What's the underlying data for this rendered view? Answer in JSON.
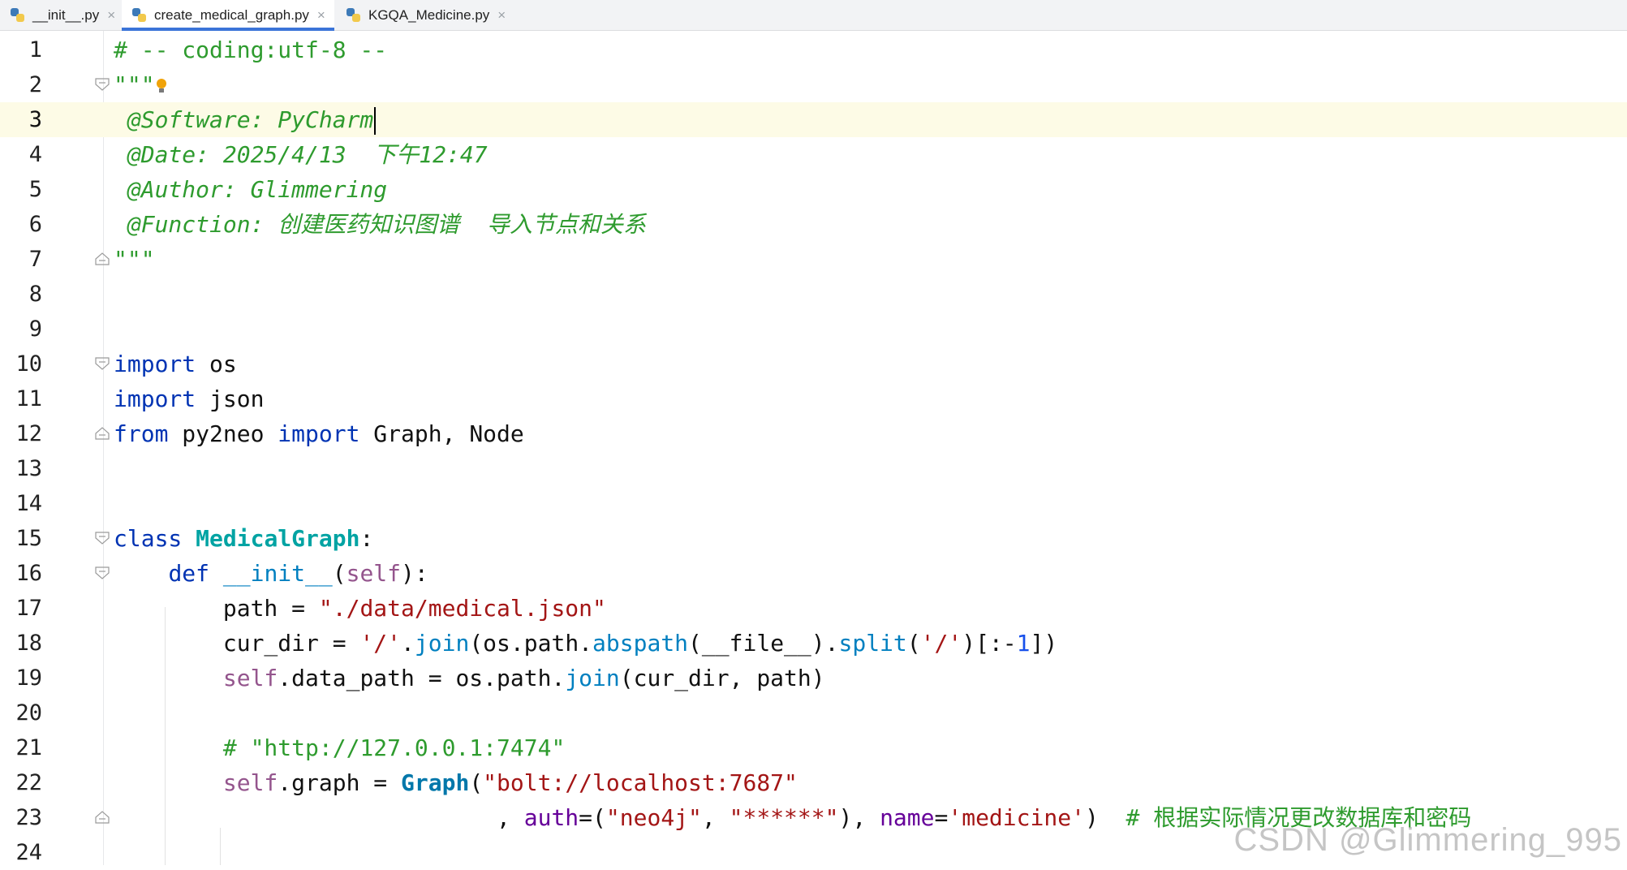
{
  "tabs": [
    {
      "label": "__init__.py",
      "close": "×"
    },
    {
      "label": "create_medical_graph.py",
      "close": "×"
    },
    {
      "label": "KGQA_Medicine.py",
      "close": "×"
    }
  ],
  "editor": {
    "current_line": 3,
    "lines": [
      {
        "n": "1"
      },
      {
        "n": "2"
      },
      {
        "n": "3"
      },
      {
        "n": "4"
      },
      {
        "n": "5"
      },
      {
        "n": "6"
      },
      {
        "n": "7"
      },
      {
        "n": "8"
      },
      {
        "n": "9"
      },
      {
        "n": "10"
      },
      {
        "n": "11"
      },
      {
        "n": "12"
      },
      {
        "n": "13"
      },
      {
        "n": "14"
      },
      {
        "n": "15"
      },
      {
        "n": "16"
      },
      {
        "n": "17"
      },
      {
        "n": "18"
      },
      {
        "n": "19"
      },
      {
        "n": "20"
      },
      {
        "n": "21"
      },
      {
        "n": "22"
      },
      {
        "n": "23"
      },
      {
        "n": "24"
      }
    ],
    "code": {
      "l1": "# -- coding:utf-8 --",
      "l2_q": "\"\"\"",
      "l3": " @Software: PyCharm",
      "l4": " @Date: 2025/4/13  下午12:47",
      "l5": " @Author: Glimmering",
      "l6": " @Function: 创建医药知识图谱  导入节点和关系",
      "l7": "\"\"\"",
      "l10_kw": "import",
      "l10_rest": " os",
      "l11_kw": "import",
      "l11_rest": " json",
      "l12_kw1": "from",
      "l12_mod": " py2neo ",
      "l12_kw2": "import",
      "l12_rest": " Graph, Node",
      "l15_kw": "class",
      "l15_sp": " ",
      "l15_cls": "MedicalGraph",
      "l15_end": ":",
      "l16_indent": "    ",
      "l16_kw": "def",
      "l16_name": " __init__",
      "l16_p1": "(",
      "l16_self": "self",
      "l16_p2": "):",
      "l17_indent": "        ",
      "l17_a": "path = ",
      "l17_str": "\"./data/medical.json\"",
      "l18_indent": "        ",
      "l18_a": "cur_dir = ",
      "l18_s1": "'/'",
      "l18_dot": ".",
      "l18_join": "join",
      "l18_b": "(os.path.",
      "l18_abs": "abspath",
      "l18_c": "(__file__).",
      "l18_split": "split",
      "l18_d": "(",
      "l18_s2": "'/'",
      "l18_e": ")[:-",
      "l18_num": "1",
      "l18_f": "])",
      "l19_indent": "        ",
      "l19_self": "self",
      "l19_a": ".data_path = os.path.",
      "l19_join": "join",
      "l19_b": "(cur_dir, path)",
      "l21_indent": "        ",
      "l21_cmt": "# \"http://127.0.0.1:7474\"",
      "l22_indent": "        ",
      "l22_self": "self",
      "l22_a": ".graph = ",
      "l22_graph": "Graph",
      "l22_b": "(",
      "l22_str": "\"bolt://localhost:7687\"",
      "l23_indent": "                           ",
      "l23_a": " , ",
      "l23_auth": "auth",
      "l23_b": "=(",
      "l23_s1": "\"neo4j\"",
      "l23_c": ", ",
      "l23_s2": "\"******\"",
      "l23_d": "), ",
      "l23_name": "name",
      "l23_e": "=",
      "l23_s3": "'medicine'",
      "l23_f": ")  ",
      "l23_cmt": "# 根据实际情况更改数据库和密码"
    }
  },
  "watermark": "CSDN @Glimmering_995"
}
